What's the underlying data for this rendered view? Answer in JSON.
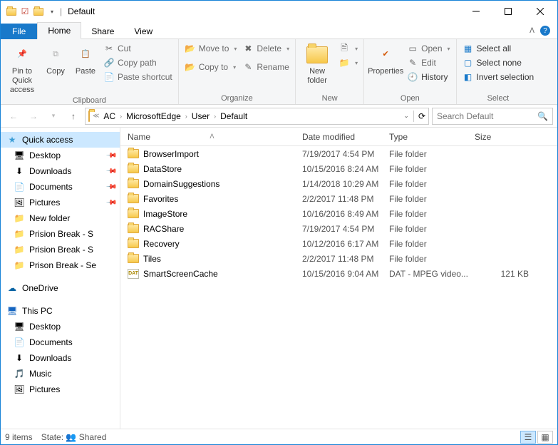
{
  "window": {
    "title": "Default"
  },
  "tabs": {
    "file": "File",
    "home": "Home",
    "share": "Share",
    "view": "View"
  },
  "ribbon": {
    "clipboard": {
      "label": "Clipboard",
      "pin": "Pin to Quick access",
      "copy": "Copy",
      "paste": "Paste",
      "cut": "Cut",
      "copypath": "Copy path",
      "shortcut": "Paste shortcut"
    },
    "organize": {
      "label": "Organize",
      "moveto": "Move to",
      "copyto": "Copy to",
      "delete": "Delete",
      "rename": "Rename"
    },
    "new": {
      "label": "New",
      "newfolder": "New folder"
    },
    "open": {
      "label": "Open",
      "properties": "Properties",
      "open": "Open",
      "edit": "Edit",
      "history": "History"
    },
    "select": {
      "label": "Select",
      "all": "Select all",
      "none": "Select none",
      "invert": "Invert selection"
    }
  },
  "breadcrumb": [
    "AC",
    "MicrosoftEdge",
    "User",
    "Default"
  ],
  "search": {
    "placeholder": "Search Default"
  },
  "columns": {
    "name": "Name",
    "date": "Date modified",
    "type": "Type",
    "size": "Size"
  },
  "nav": {
    "quick": "Quick access",
    "quick_items": [
      {
        "label": "Desktop",
        "pin": true
      },
      {
        "label": "Downloads",
        "pin": true
      },
      {
        "label": "Documents",
        "pin": true
      },
      {
        "label": "Pictures",
        "pin": true
      },
      {
        "label": "New folder",
        "pin": false
      },
      {
        "label": "Prision Break - S",
        "pin": false
      },
      {
        "label": "Prision Break - S",
        "pin": false
      },
      {
        "label": "Prison Break - Se",
        "pin": false
      }
    ],
    "onedrive": "OneDrive",
    "thispc": "This PC",
    "pc_items": [
      "Desktop",
      "Documents",
      "Downloads",
      "Music",
      "Pictures"
    ]
  },
  "files": [
    {
      "name": "BrowserImport",
      "date": "7/19/2017 4:54 PM",
      "type": "File folder",
      "size": "",
      "icon": "folder"
    },
    {
      "name": "DataStore",
      "date": "10/15/2016 8:24 AM",
      "type": "File folder",
      "size": "",
      "icon": "folder"
    },
    {
      "name": "DomainSuggestions",
      "date": "1/14/2018 10:29 AM",
      "type": "File folder",
      "size": "",
      "icon": "folder"
    },
    {
      "name": "Favorites",
      "date": "2/2/2017 11:48 PM",
      "type": "File folder",
      "size": "",
      "icon": "folder"
    },
    {
      "name": "ImageStore",
      "date": "10/16/2016 8:49 AM",
      "type": "File folder",
      "size": "",
      "icon": "folder"
    },
    {
      "name": "RACShare",
      "date": "7/19/2017 4:54 PM",
      "type": "File folder",
      "size": "",
      "icon": "folder"
    },
    {
      "name": "Recovery",
      "date": "10/12/2016 6:17 AM",
      "type": "File folder",
      "size": "",
      "icon": "folder"
    },
    {
      "name": "Tiles",
      "date": "2/2/2017 11:48 PM",
      "type": "File folder",
      "size": "",
      "icon": "folder"
    },
    {
      "name": "SmartScreenCache",
      "date": "10/15/2016 9:04 AM",
      "type": "DAT - MPEG video...",
      "size": "121 KB",
      "icon": "dat"
    }
  ],
  "status": {
    "items": "9 items",
    "state_label": "State:",
    "state_value": "Shared"
  }
}
